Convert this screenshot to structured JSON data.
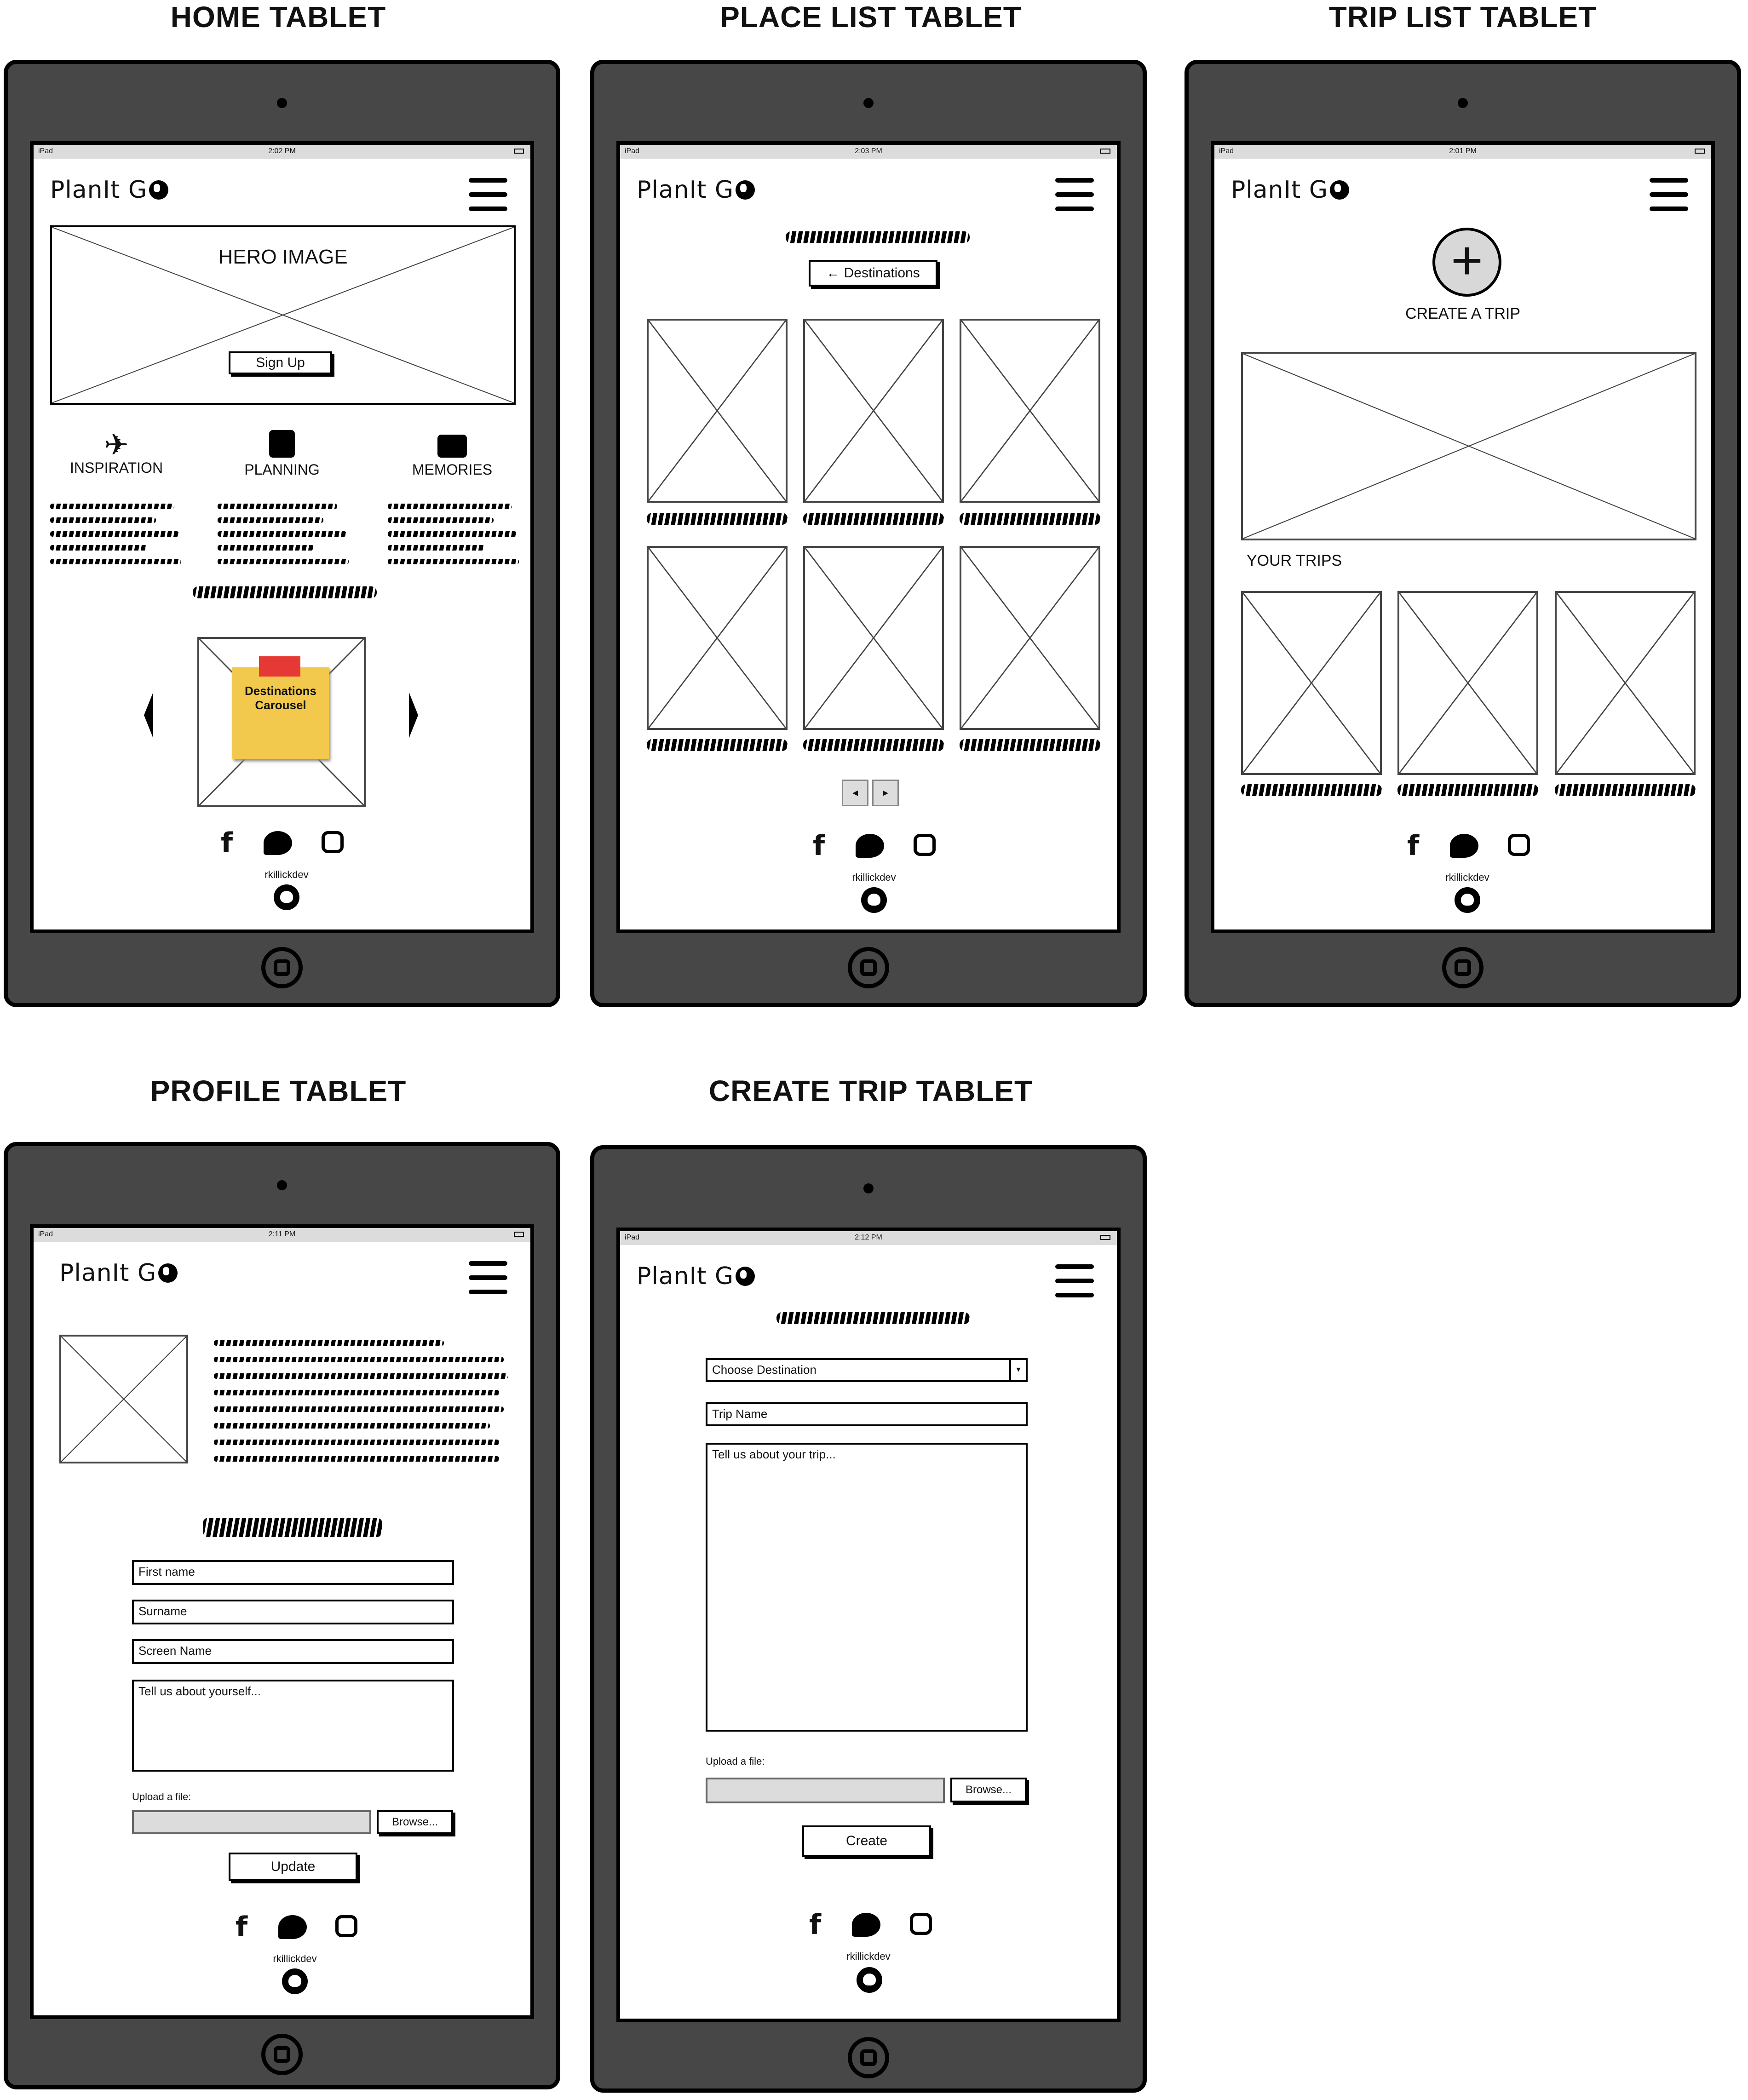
{
  "titles": {
    "home": "HOME TABLET",
    "place_list": "PLACE LIST TABLET",
    "trip_list": "TRIP LIST TABLET",
    "profile": "PROFILE TABLET",
    "create_trip": "CREATE TRIP TABLET"
  },
  "brand": "PlanIt G",
  "status": {
    "carrier": "iPad",
    "time_home": "2:02 PM",
    "time_place": "2:03 PM",
    "time_trip": "2:01 PM",
    "time_profile": "2:11 PM",
    "time_create": "2:12 PM"
  },
  "home": {
    "hero": "HERO IMAGE",
    "signup": "Sign Up",
    "features": [
      "INSPIRATION",
      "PLANNING",
      "MEMORIES"
    ],
    "carousel_note": "Destinations Carousel"
  },
  "place_list": {
    "back_button": "Destinations"
  },
  "trip_list": {
    "create": "CREATE A TRIP",
    "your_trips": "YOUR TRIPS"
  },
  "profile": {
    "first_name": "First name",
    "surname": "Surname",
    "screen_name": "Screen Name",
    "about": "Tell us about yourself...",
    "upload": "Upload a file:",
    "browse": "Browse...",
    "update": "Update"
  },
  "create_trip": {
    "destination": "Choose Destination",
    "trip_name": "Trip Name",
    "about": "Tell us about your trip...",
    "upload": "Upload a file:",
    "browse": "Browse...",
    "create": "Create"
  },
  "footer": {
    "handle": "rkillickdev"
  },
  "icons": [
    "facebook-icon",
    "twitter-icon",
    "instagram-icon",
    "github-icon",
    "airplane-icon",
    "checklist-icon",
    "camera-icon",
    "menu-icon",
    "globe-icon"
  ]
}
